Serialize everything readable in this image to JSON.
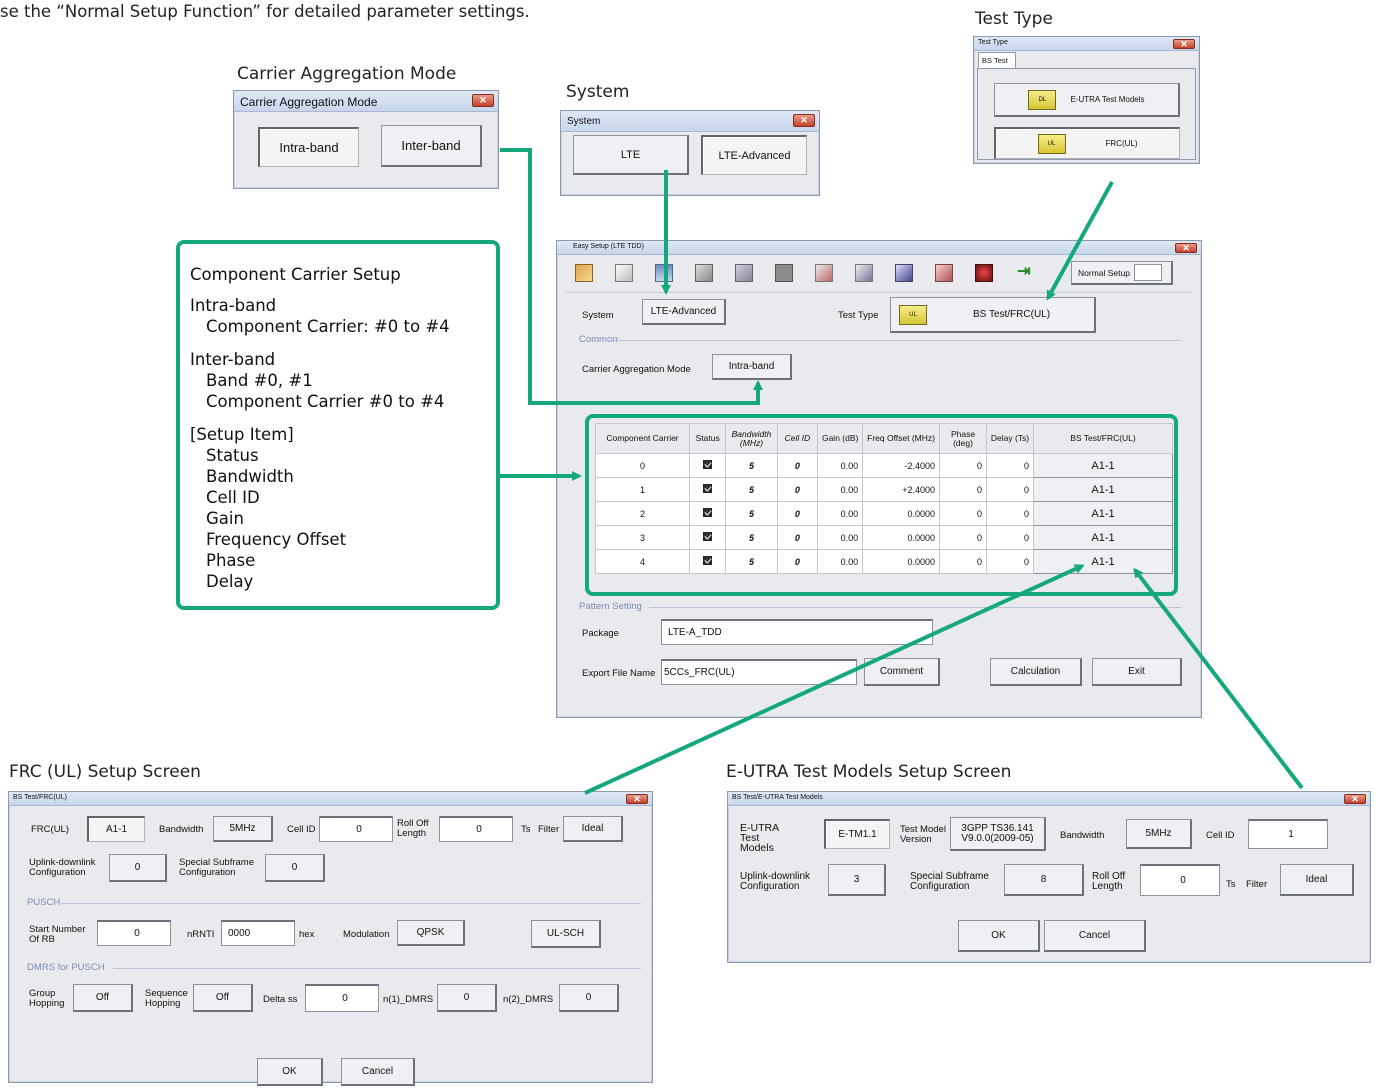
{
  "intro_text": "se the “Normal Setup Function” for detailed parameter settings.",
  "captions": {
    "ca_mode": "Carrier Aggregation Mode",
    "system": "System",
    "test_type": "Test Type",
    "frc": "FRC (UL) Setup Screen",
    "etm": "E-UTRA Test Models Setup Screen"
  },
  "ca_window": {
    "title": "Carrier Aggregation Mode",
    "intra": "Intra-band",
    "inter": "Inter-band"
  },
  "system_window": {
    "title": "System",
    "lte": "LTE",
    "lte_adv": "LTE-Advanced"
  },
  "testtype_window": {
    "title": "Test Type",
    "tab": "BS Test",
    "etm_btn": "E-UTRA Test Models",
    "frc_btn": "FRC(UL)",
    "icon_dl": "DL",
    "icon_ul": "UL"
  },
  "cc_box": {
    "title": "Component Carrier Setup",
    "intra_h": "Intra-band",
    "intra_1": "Component Carrier:  #0 to #4",
    "inter_h": "Inter-band",
    "inter_1": "Band #0, #1",
    "inter_2": "Component Carrier #0 to #4",
    "setup_h": "[Setup Item]",
    "items": [
      "Status",
      "Bandwidth",
      "Cell ID",
      "Gain",
      "Frequency Offset",
      "Phase",
      "Delay"
    ]
  },
  "easy": {
    "title": "Easy Setup (LTE TDD)",
    "normal_setup": "Normal Setup",
    "system_lbl": "System",
    "system_val": "LTE-Advanced",
    "testtype_lbl": "Test Type",
    "testtype_val": "BS Test/FRC(UL)",
    "common": "Common",
    "ca_lbl": "Carrier Aggregation Mode",
    "ca_val": "Intra-band",
    "table_headers": [
      "Component Carrier",
      "Status",
      "Bandwidth (MHz)",
      "Cell ID",
      "Gain (dB)",
      "Freq Offset (MHz)",
      "Phase (deg)",
      "Delay (Ts)",
      "BS Test/FRC(UL)"
    ],
    "rows": [
      {
        "cc": "0",
        "bw": "5",
        "cell": "0",
        "gain": "0.00",
        "freq": "-2.4000",
        "phase": "0",
        "delay": "0",
        "test": "A1-1"
      },
      {
        "cc": "1",
        "bw": "5",
        "cell": "0",
        "gain": "0.00",
        "freq": "+2.4000",
        "phase": "0",
        "delay": "0",
        "test": "A1-1"
      },
      {
        "cc": "2",
        "bw": "5",
        "cell": "0",
        "gain": "0.00",
        "freq": "0.0000",
        "phase": "0",
        "delay": "0",
        "test": "A1-1"
      },
      {
        "cc": "3",
        "bw": "5",
        "cell": "0",
        "gain": "0.00",
        "freq": "0.0000",
        "phase": "0",
        "delay": "0",
        "test": "A1-1"
      },
      {
        "cc": "4",
        "bw": "5",
        "cell": "0",
        "gain": "0.00",
        "freq": "0.0000",
        "phase": "0",
        "delay": "0",
        "test": "A1-1"
      }
    ],
    "pattern": "Pattern Setting",
    "package_lbl": "Package",
    "package_val": "LTE-A_TDD",
    "export_lbl": "Export File Name",
    "export_val": "5CCs_FRC(UL)",
    "comment": "Comment",
    "calculation": "Calculation",
    "exit": "Exit"
  },
  "frc": {
    "title": "BS Test/FRC(UL)",
    "frc_lbl": "FRC(UL)",
    "frc_val": "A1-1",
    "bw_lbl": "Bandwidth",
    "bw_val": "5MHz",
    "cell_lbl": "Cell ID",
    "cell_val": "0",
    "roll_lbl": "Roll Off Length",
    "roll_val": "0",
    "ts_lbl": "Ts",
    "filter_lbl": "Filter",
    "filter_val": "Ideal",
    "uldl_lbl": "Uplink-downlink Configuration",
    "uldl_val": "0",
    "ssf_lbl": "Special Subframe Configuration",
    "ssf_val": "0",
    "pusch": "PUSCH",
    "srb_lbl": "Start Number Of RB",
    "srb_val": "0",
    "nrnti_lbl": "nRNTI",
    "nrnti_val": "0000",
    "hex": "hex",
    "mod_lbl": "Modulation",
    "mod_val": "QPSK",
    "ulsch": "UL-SCH",
    "dmrs": "DMRS for PUSCH",
    "gh_lbl": "Group Hopping",
    "gh_val": "Off",
    "sh_lbl": "Sequence Hopping",
    "sh_val": "Off",
    "dss_lbl": "Delta ss",
    "dss_val": "0",
    "n1_lbl": "n(1)_DMRS",
    "n1_val": "0",
    "n2_lbl": "n(2)_DMRS",
    "n2_val": "0",
    "ok": "OK",
    "cancel": "Cancel"
  },
  "etm": {
    "title": "BS Test/E-UTRA Test Models",
    "etm_lbl": "E-UTRA Test Models",
    "etm_val": "E-TM1.1",
    "tmv_lbl": "Test Model Version",
    "tmv_val": "3GPP TS36.141 V9.0.0(2009-05)",
    "bw_lbl": "Bandwidth",
    "bw_val": "5MHz",
    "cell_lbl": "Cell ID",
    "cell_val": "1",
    "uldl_lbl": "Uplink-downlink Configuration",
    "uldl_val": "3",
    "ssf_lbl": "Special Subframe Configuration",
    "ssf_val": "8",
    "roll_lbl": "Roll Off Length",
    "roll_val": "0",
    "ts_lbl": "Ts",
    "filter_lbl": "Filter",
    "filter_val": "Ideal",
    "ok": "OK",
    "cancel": "Cancel"
  },
  "colors": {
    "arrow": "#16a87d"
  }
}
